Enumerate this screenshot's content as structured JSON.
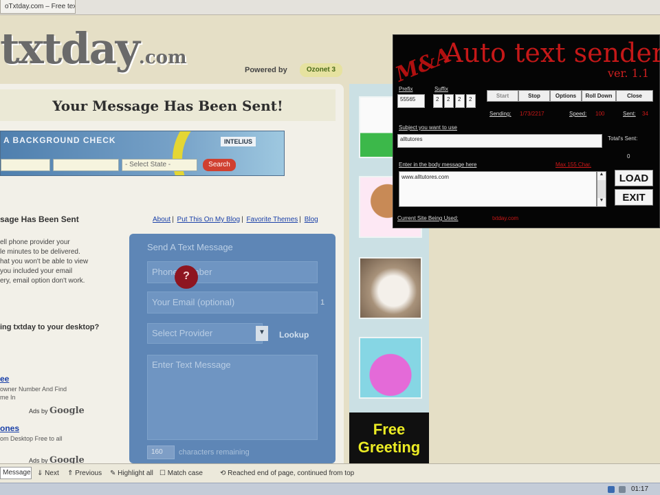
{
  "browser": {
    "tab_title": "oTxtday.com – Free text messaging – SMS another! - ..."
  },
  "site": {
    "logo_text": "txtday",
    "logo_suffix": ".com",
    "powered_by": "Powered by",
    "powered_badge": "Ozonet 3"
  },
  "page": {
    "sent_title": "Your Message Has Been Sent!",
    "bg_banner": {
      "text": "A BACKGROUND CHECK",
      "brand": "INTELIUS",
      "select_value": "- Select State -",
      "search_label": "Search"
    },
    "sub_title": "sage Has Been Sent",
    "body_lines": [
      "ell phone provider your",
      "le minutes to be delivered.",
      "hat you won't be able to view",
      "you included your email",
      "ery, email option don't work."
    ],
    "desktop_question": "ing txtday to your desktop?",
    "ads": [
      {
        "link": "ee",
        "lines": [
          "owner Number And Find",
          "me In"
        ]
      },
      {
        "link": "ones",
        "lines": [
          "om Desktop Free to all"
        ]
      }
    ],
    "ads_by": "Ads by",
    "ads_by_brand": "Google",
    "top_links": [
      "About",
      "Put This On My Blog",
      "Favorite Themes",
      "Blog"
    ],
    "sms": {
      "header": "Send A Text Message",
      "phone_placeholder": "Phone Number",
      "email_placeholder": "Your Email (optional)",
      "provider_value": "Select Provider",
      "lookup_label": "Lookup",
      "message_placeholder": "Enter Text Message",
      "count_box": "160",
      "count_label": "characters remaining",
      "side_number": "1"
    },
    "help_marker": "?",
    "greeting_ad": [
      "Free",
      "Greeting"
    ]
  },
  "auto_text_sender": {
    "mark": "M&A",
    "title": "Auto text sender",
    "version": "ver. 1.1",
    "labels": {
      "prefix": "Prefix",
      "suffix": "Suffix",
      "subject": "Subject you want to use",
      "body": "Enter in the body message here",
      "total": "Total's Sent:",
      "current_site": "Current Site Being Used:"
    },
    "prefix_value": "55565",
    "suffix_digits": [
      "2",
      "2",
      "2",
      "2"
    ],
    "buttons": [
      "Start",
      "Stop",
      "Options",
      "Roll Down",
      "Close"
    ],
    "stats": {
      "sending_label": "Sending:",
      "sending_value": "1/73/2217",
      "speed_label": "Speed:",
      "speed_value": "100",
      "sent_label": "Sent:",
      "sent_value": "34"
    },
    "subject_value": "alltutores",
    "total_value": "0",
    "body_value": "www.alltutores.com",
    "body_counter": "Max 155 Char.",
    "load_label": "LOAD",
    "exit_label": "EXIT",
    "site_value": "txtday.com"
  },
  "findbar": {
    "find_label": "Message",
    "next_label": "Next",
    "previous_label": "Previous",
    "highlight_label": "Highlight all",
    "match_case_label": "Match case",
    "status": "Reached end of page, continued from top"
  },
  "taskbar": {
    "clock": "01:17"
  },
  "colors": {
    "ats_red": "#c41818",
    "sms_panel": "#5e86b6",
    "page_bg": "#e5dfc6"
  }
}
